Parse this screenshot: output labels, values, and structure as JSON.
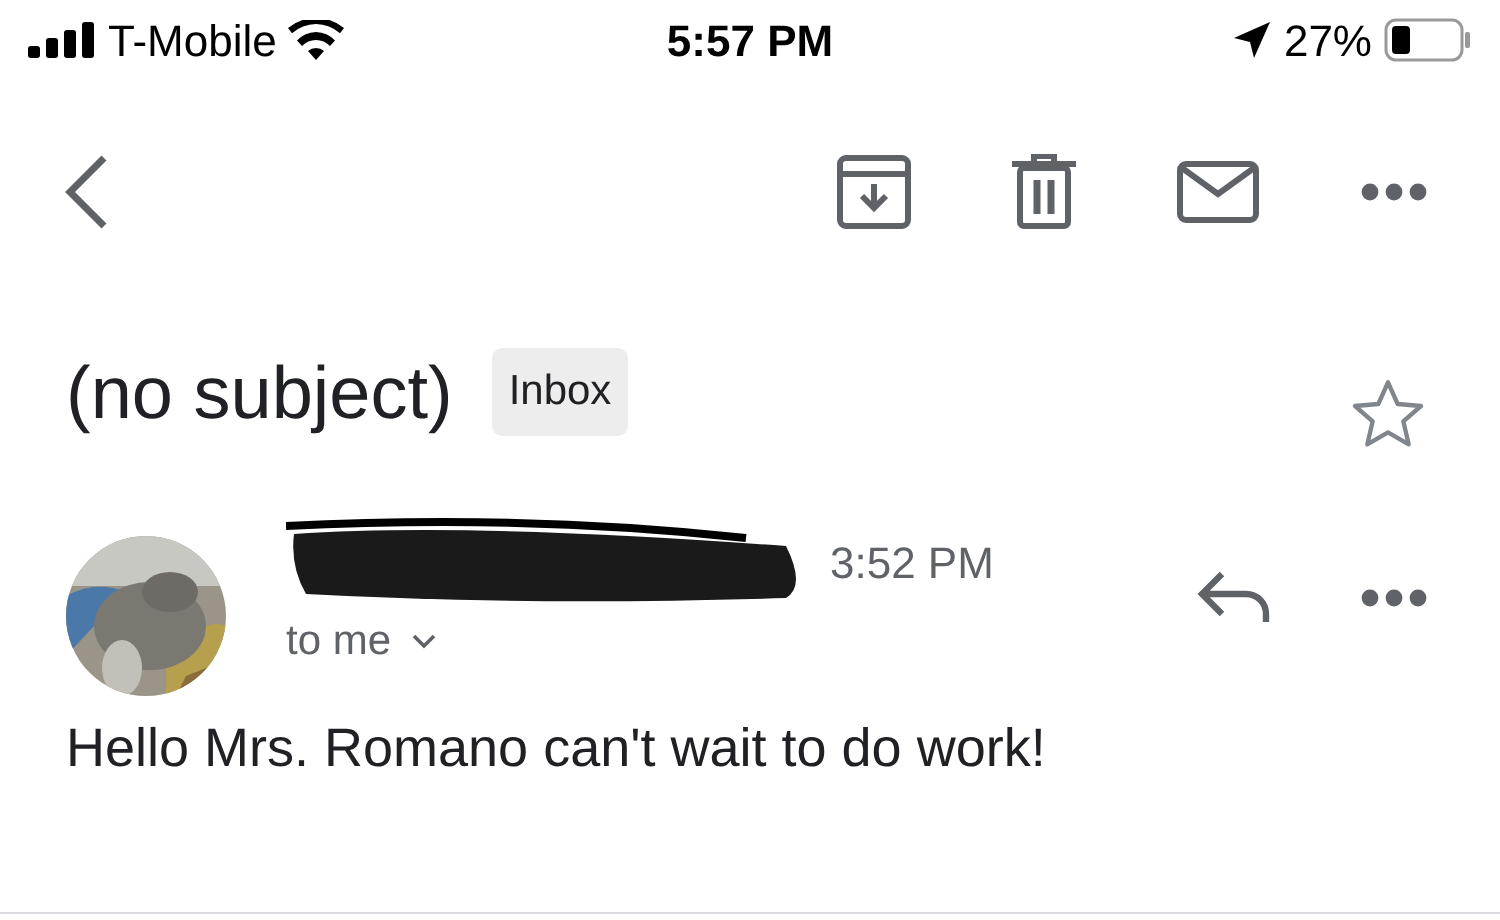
{
  "status_bar": {
    "carrier": "T-Mobile",
    "time": "5:57 PM",
    "battery": "27%"
  },
  "message": {
    "subject": "(no subject)",
    "label": "Inbox",
    "starred": false,
    "sent_time": "3:52 PM",
    "recipient": "to me",
    "body": "Hello Mrs. Romano can't wait to do work!"
  }
}
